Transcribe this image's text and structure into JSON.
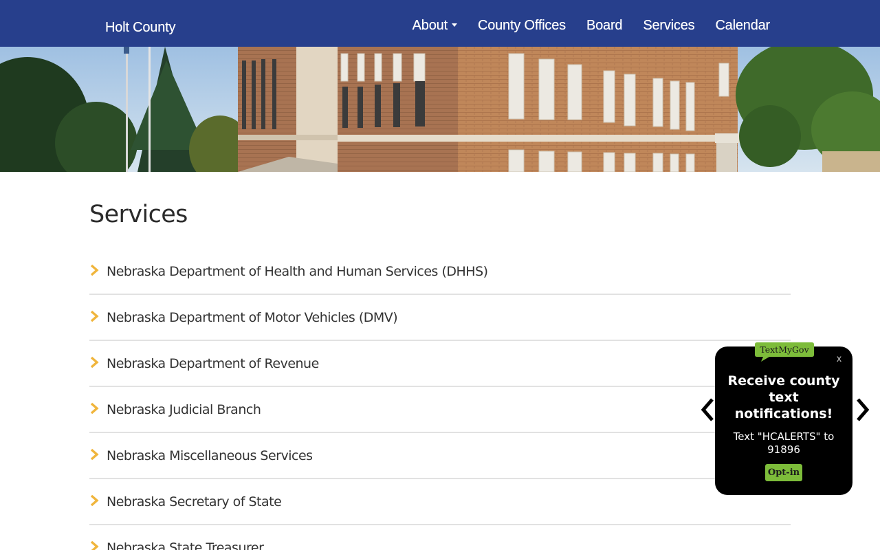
{
  "brand": "Holt County",
  "nav": {
    "items": [
      "About",
      "County Offices",
      "Board",
      "Services",
      "Calendar"
    ]
  },
  "page": {
    "title": "Services",
    "services": [
      "Nebraska Department of Health and Human Services (DHHS)",
      "Nebraska Department of Motor Vehicles (DMV)",
      "Nebraska Department of Revenue",
      "Nebraska Judicial Branch",
      "Nebraska Miscellaneous Services",
      "Nebraska Secretary of State",
      "Nebraska State Treasurer"
    ]
  },
  "popup": {
    "badge": "TextMyGov",
    "close": "x",
    "heading": "Receive county text notifications!",
    "text": "Text \"HCALERTS\" to 91896",
    "button": "Opt-in"
  },
  "colors": {
    "navbar": "#273f8c",
    "chevron": "#f0b53c",
    "optin": "#7dbc3a"
  }
}
